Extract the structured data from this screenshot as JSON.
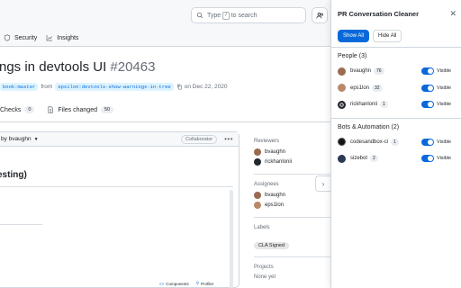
{
  "github": {
    "search_placeholder_prefix": "Type",
    "search_key": "/",
    "search_placeholder_suffix": "to search",
    "nav": [
      {
        "label": "Security",
        "icon": "shield-icon"
      },
      {
        "label": "Insights",
        "icon": "graph-icon"
      }
    ],
    "title_text": "ngs in devtools UI",
    "title_number": "#20463",
    "meta": {
      "base_branch": "book:master",
      "from_word": "from",
      "head_branch": "eps1lon:devtools-show-warnings-in-tree",
      "date": "on Dec 22, 2020"
    },
    "tabs": [
      {
        "label": "Checks",
        "count": "0",
        "icon": "checks-icon"
      },
      {
        "label": "Files changed",
        "count": "50",
        "icon": "files-icon"
      }
    ],
    "comment": {
      "author": "by bvaughn",
      "role": "Collaborator",
      "heading": "esting)",
      "footer_components": "Components",
      "footer_profiler": "Profiler"
    },
    "sidebar": {
      "reviewers_heading": "Reviewers",
      "reviewers": [
        "bvaughn",
        "rickhanlonii"
      ],
      "assignees_heading": "Assignees",
      "assignees": [
        "bvaughn",
        "eps1lon"
      ],
      "labels_heading": "Labels",
      "label": "CLA Signed",
      "projects_heading": "Projects",
      "projects_value": "None yet"
    }
  },
  "panel": {
    "title": "PR Conversation Cleaner",
    "show_all": "Show All",
    "hide_all": "Hide All",
    "people_heading": "People (3)",
    "people": [
      {
        "name": "bvaughn",
        "count": "76",
        "status": "Visible",
        "avatar_color": "#9a6b4f"
      },
      {
        "name": "eps1lon",
        "count": "32",
        "status": "Visible",
        "avatar_color": "#b98a6a"
      },
      {
        "name": "rickhanlonii",
        "count": "1",
        "status": "Visible",
        "avatar_color": "#24292f"
      }
    ],
    "bots_heading": "Bots & Automation (2)",
    "bots": [
      {
        "name": "codesandbox-ci",
        "count": "1",
        "status": "Visible",
        "avatar_color": "#151515"
      },
      {
        "name": "sizebot",
        "count": "2",
        "status": "Visible",
        "avatar_color": "#2b3a55"
      }
    ]
  },
  "colors": {
    "accent": "#0969da",
    "border": "#d0d7de"
  }
}
